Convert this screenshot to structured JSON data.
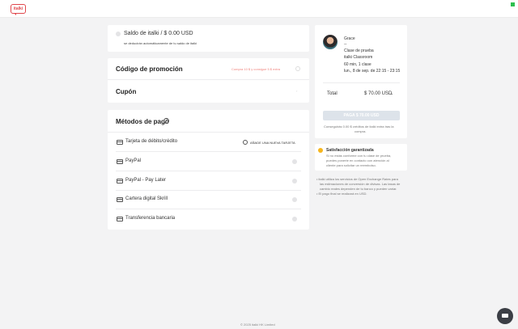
{
  "logo": "italki",
  "balance": {
    "label": "Saldo de italki / $ 0.00 USD",
    "note": "se deducirán automáticamente de tu saldo de italki"
  },
  "promo": {
    "title": "Código de promoción",
    "hint": "Compra 10 $ y consigue 5 $ extra"
  },
  "coupon": {
    "title": "Cupón"
  },
  "payment": {
    "title": "Métodos de pago",
    "add_card": "AÑADE UNA NUEVA TARJETA",
    "methods": [
      {
        "label": "Tarjeta de débito/crédito",
        "icon": "credit-card-icon"
      },
      {
        "label": "PayPal",
        "icon": "paypal-icon"
      },
      {
        "label": "PayPal - Pay Later",
        "icon": "paypal-icon"
      },
      {
        "label": "Cartera digital Skrill",
        "icon": "wallet-icon"
      },
      {
        "label": "Transferencia bancaria",
        "icon": "bank-card-icon"
      }
    ]
  },
  "summary": {
    "teacher": "Grace",
    "dash": "--",
    "lesson_type": "Clase de prueba",
    "classroom": "italki Classroom",
    "duration": "60 min, 1 clase",
    "datetime": "lun., 8 de sep. de 22:15 - 23:15",
    "total_label": "Total",
    "total_value": "$ 70.00 USD",
    "pay_button": "PAGA $ 70.00 USD",
    "credits_note_1": "Conseguirás 0.00 $ créditos de italki extra tras la",
    "credits_note_2": "compra."
  },
  "guarantee": {
    "title": "Satisfacción garantizada",
    "line1": "Si no estás conforme con tu clase de prueba,",
    "line2": "puedes ponerte en contacto con atención al",
    "line3": "cliente para solicitar un reembolso."
  },
  "exchange_notes": [
    "italki utiliza los servicios de Open Exchange Rates para",
    "las estimaciones de conversión de divisas. Las tasas de",
    "cambio reales dependen de tu banco y pueden variar.",
    "El pago final se realizará en USD."
  ],
  "footer": "© 2025 italki HK Limited",
  "colors": {
    "accent_red": "#e0474c",
    "promo_hint": "#f0857f",
    "gold": "#f6b61e"
  }
}
